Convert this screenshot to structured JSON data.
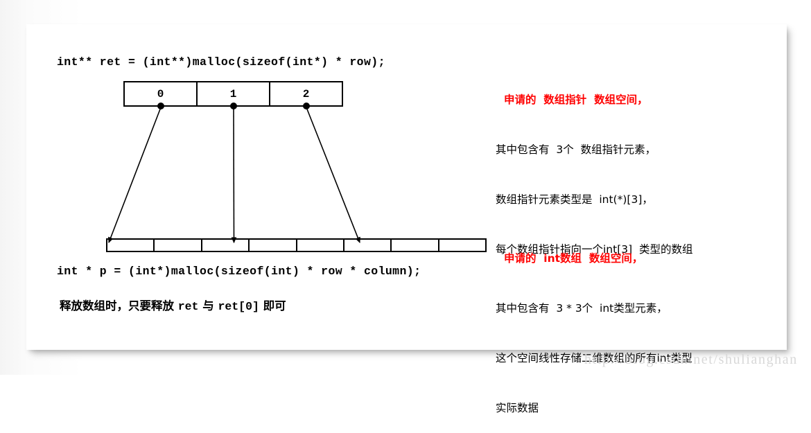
{
  "code": {
    "top": "int** ret = (int**)malloc(sizeof(int*) * row);",
    "bottom": "int * p = (int*)malloc(sizeof(int) * row * column);"
  },
  "free_note": {
    "part1": "释放数组时，只要释放 ",
    "mono1": "ret",
    "part2": " 与 ",
    "mono2": "ret[0]",
    "part3": " 即可"
  },
  "pointer_array": {
    "cells": [
      "0",
      "1",
      "2"
    ]
  },
  "int_array": {
    "cells": [
      "",
      "",
      "",
      "",
      "",
      "",
      "",
      ""
    ]
  },
  "annotations": {
    "pointer": {
      "heading": "申请的  数组指针  数组空间，",
      "line1": "其中包含有  3个  数组指针元素，",
      "line2": "数组指针元素类型是  int(*)[3]，",
      "line3": "每个数组指针指向一个int[3]  类型的数组"
    },
    "int": {
      "heading": "申请的  int数组  数组空间，",
      "line1": "其中包含有  3 * 3个  int类型元素，",
      "line2": "这个空间线性存储二维数组的所有int类型",
      "line3": "实际数据"
    }
  },
  "watermark": {
    "text": "http://blog.csdn.net/shulianghan"
  },
  "colors": {
    "accent_red": "#ff0000",
    "stroke": "#000000",
    "card": "#ffffff",
    "watermark": "#d8d8d8"
  }
}
